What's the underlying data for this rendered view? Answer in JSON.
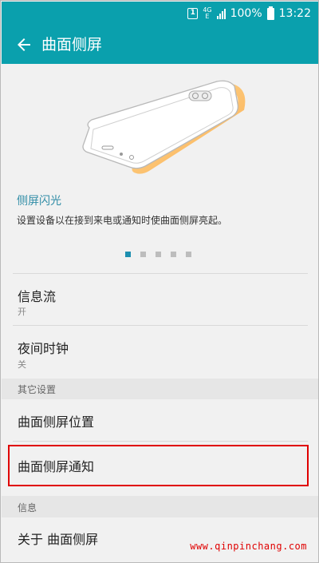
{
  "status_bar": {
    "sim_label": "1",
    "network_top": "4G",
    "network_bottom": "E",
    "battery": "100%",
    "time": "13:22"
  },
  "app_bar": {
    "title": "曲面侧屏",
    "back_icon": "arrow-left-icon"
  },
  "feature": {
    "title": "侧屏闪光",
    "description": "设置设备以在接到来电或通知时使曲面侧屏亮起。"
  },
  "pager": {
    "count": 5,
    "active_index": 0
  },
  "settings": [
    {
      "title": "信息流",
      "subtitle": "开"
    },
    {
      "title": "夜间时钟",
      "subtitle": "关"
    }
  ],
  "section_other": "其它设置",
  "other_settings": [
    {
      "title": "曲面侧屏位置"
    },
    {
      "title": "曲面侧屏通知"
    }
  ],
  "section_info": "信息",
  "info_settings": [
    {
      "title": "关于 曲面侧屏"
    }
  ],
  "watermark": "www.qinpinchang.com",
  "colors": {
    "accent": "#0aa0ad",
    "highlight_border": "#e00000",
    "feature_title": "#2f8ca6"
  }
}
